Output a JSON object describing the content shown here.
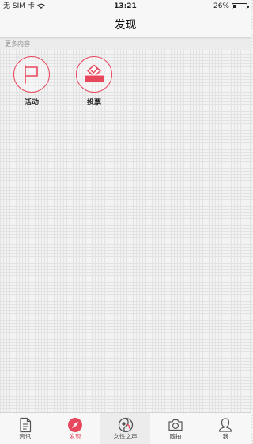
{
  "status_bar": {
    "carrier": "无 SIM 卡",
    "time": "13:21",
    "battery_text": "26%",
    "battery_level": 0.26
  },
  "nav": {
    "title": "发现"
  },
  "section": {
    "label": "更多内容"
  },
  "features": [
    {
      "label": "活动",
      "icon": "flag-icon"
    },
    {
      "label": "投票",
      "icon": "ballot-box-icon"
    }
  ],
  "tabs": [
    {
      "label": "资讯",
      "icon": "news-icon",
      "active": false
    },
    {
      "label": "发现",
      "icon": "compass-icon",
      "active": true
    },
    {
      "label": "女性之声",
      "icon": "voice-logo-icon",
      "active": false
    },
    {
      "label": "随拍",
      "icon": "camera-icon",
      "active": false
    },
    {
      "label": "我",
      "icon": "profile-icon",
      "active": false
    }
  ],
  "colors": {
    "accent": "#e8485e",
    "tab_inactive": "#444444",
    "section_text": "#8e8e8e"
  }
}
